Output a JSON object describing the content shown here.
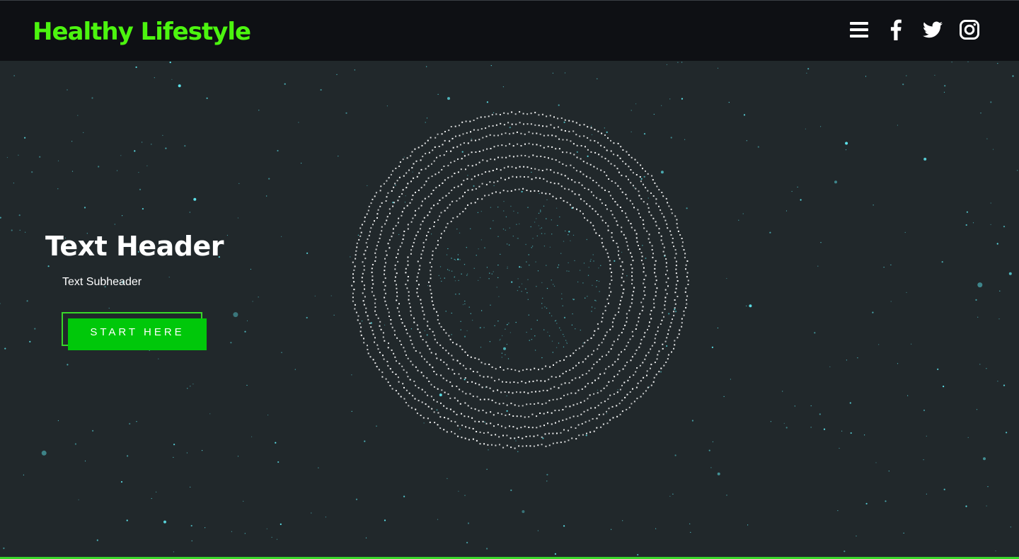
{
  "header": {
    "brand": "Healthy Lifestyle",
    "icons": [
      "menu-icon",
      "facebook-icon",
      "twitter-icon",
      "instagram-icon"
    ]
  },
  "hero": {
    "title": "Text Header",
    "subtitle": "Text Subheader",
    "cta_label": "START HERE"
  },
  "colors": {
    "page_background": "#21282b",
    "header_background": "#0e1014",
    "brand": "#4cf50f",
    "cta": "#00c80a",
    "cta_outline": "#39d62a",
    "particle": "#5ee7ef",
    "ring_dots": "#ffffff"
  }
}
